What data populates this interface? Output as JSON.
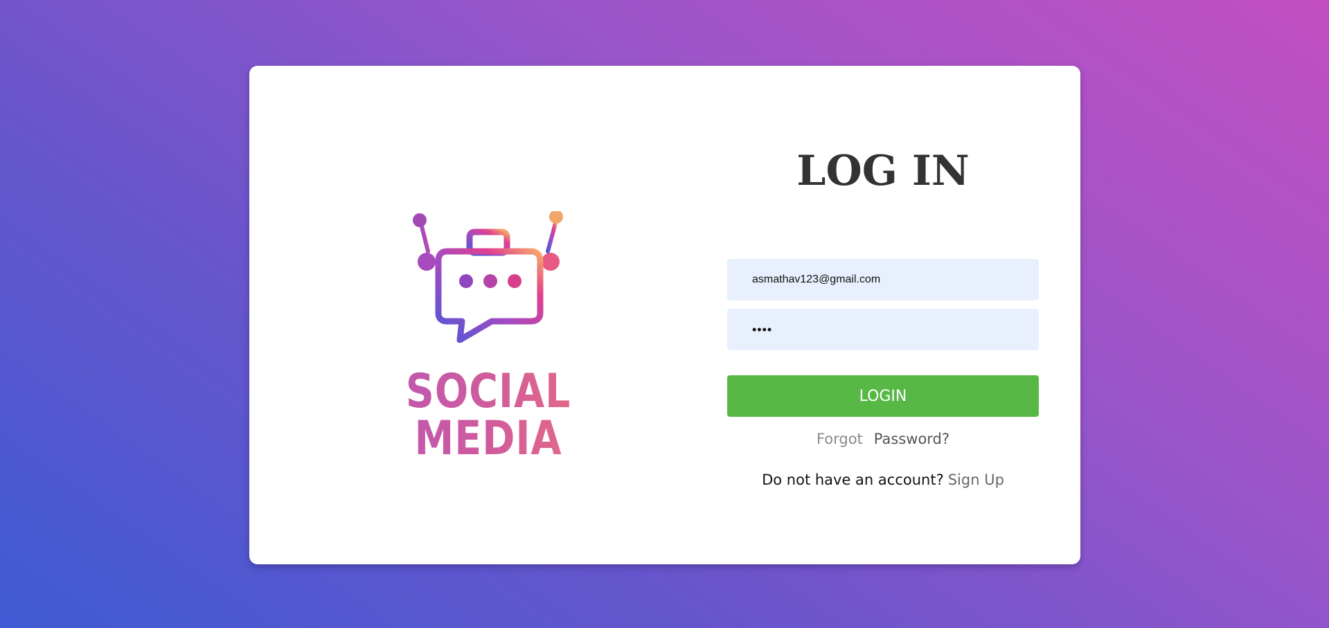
{
  "brand": {
    "name": "SOCIAL MEDIA",
    "logo_icon": "robot-chat-bubble-icon"
  },
  "login_form": {
    "title": "LOG IN",
    "email_value": "asmathav123@gmail.com",
    "password_value": "••••",
    "submit_label": "LOGIN",
    "forgot_first": "Forgot",
    "forgot_second": "Password?",
    "signup_prompt": "Do not have an account?",
    "signup_link": "Sign Up"
  },
  "colors": {
    "submit_button": "#57b846",
    "input_background": "#e8f0fd",
    "background_start": "#3f5bd3",
    "background_end": "#c24fc2"
  }
}
